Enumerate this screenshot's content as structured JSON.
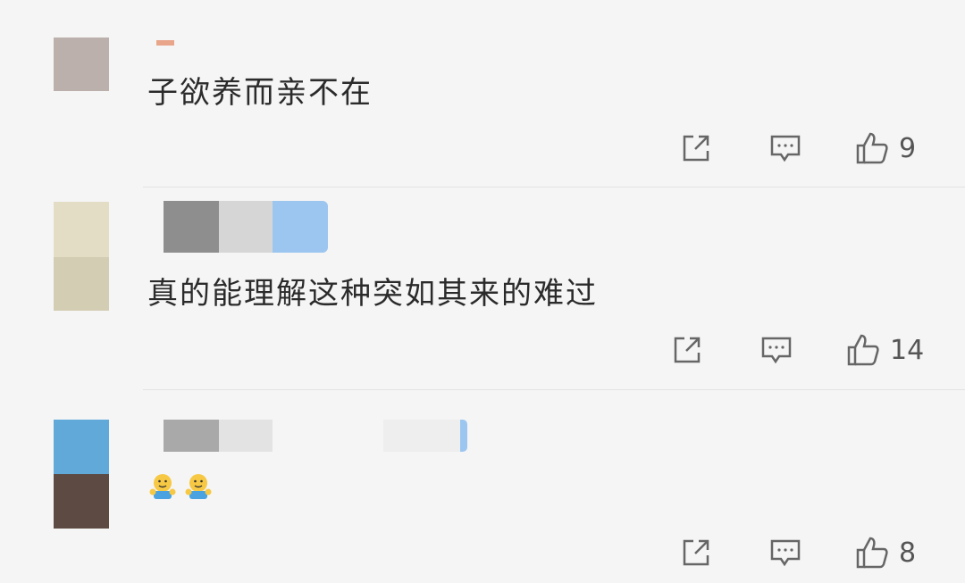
{
  "comments": [
    {
      "text": "子欲养而亲不在",
      "likes": "9"
    },
    {
      "text": "真的能理解这种突如其来的难过",
      "likes": "14"
    },
    {
      "text": "",
      "likes": "8",
      "emoji": [
        "hug-emoji",
        "hug-emoji"
      ]
    }
  ],
  "icons": {
    "share": "share-icon",
    "comment": "comment-icon",
    "like": "thumbs-up-icon"
  },
  "colors": {
    "background": "#f5f5f5",
    "text": "#2b2b2b",
    "icon": "#666666",
    "badge_blue": "#9cc6ef",
    "emoji_yellow": "#f6c843"
  }
}
